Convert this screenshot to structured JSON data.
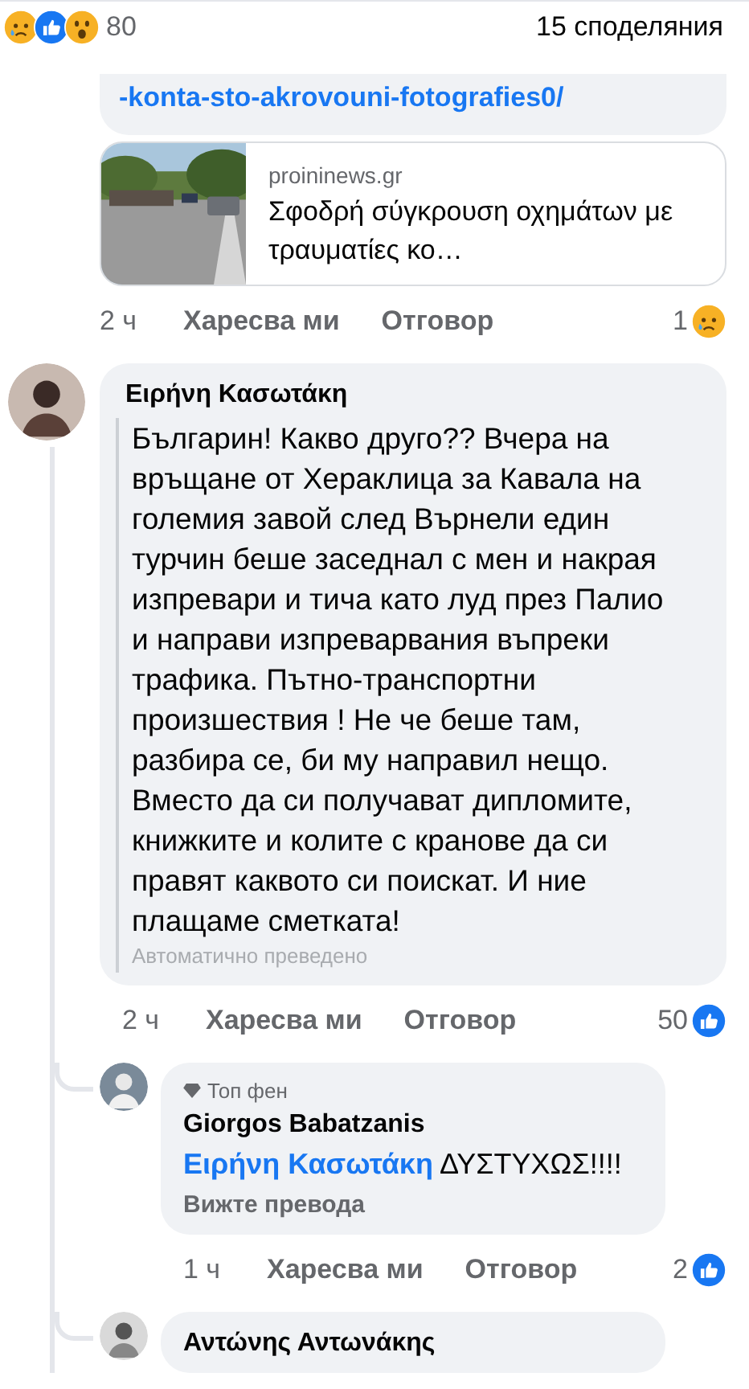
{
  "post_stats": {
    "reaction_count": "80",
    "shares": "15 споделяния"
  },
  "link_comment": {
    "link_text": "-konta-sto-akrovouni-fotografies0/",
    "preview": {
      "domain": "proininews.gr",
      "title": "Σφοδρή σύγκρουση οχημάτων με τραυματίες κο…"
    },
    "time": "2 ч",
    "like_label": "Харесва ми",
    "reply_label": "Отговор",
    "reactions": {
      "count": "1",
      "kind": "sad"
    }
  },
  "comment": {
    "author": "Ειρήνη Κασωτάκη",
    "text": "Българин! Какво друго?? Вчера на връщане от Хераклица за Кавала на големия завой след Върнели един турчин беше заседнал с мен и накрая изпревари и тича като луд през Палио и направи изпреварвания въпреки трафика. Пътно-транспортни произшествия ! Не че беше там, разбира се, би му направил нещо. Вместо да си получават дипломите, книжките и колите с кранове да си правят каквото си поискат. И ние плащаме сметката!",
    "translation_note": "Автоматично преведено",
    "time": "2 ч",
    "like_label": "Харесва ми",
    "reply_label": "Отговор",
    "reactions": {
      "count": "50",
      "kind": "like"
    },
    "replies": [
      {
        "badge": "Топ фен",
        "author": "Giorgos Babatzanis",
        "mention": "Ειρήνη Κασωτάκη",
        "text": "ΔΥΣΤΥΧΩΣ!!!!",
        "see_translation": "Вижте превода",
        "time": "1 ч",
        "like_label": "Харесва ми",
        "reply_label": "Отговор",
        "reactions": {
          "count": "2",
          "kind": "like"
        }
      },
      {
        "author": "Αντώνης Αντωνάκης"
      }
    ]
  }
}
